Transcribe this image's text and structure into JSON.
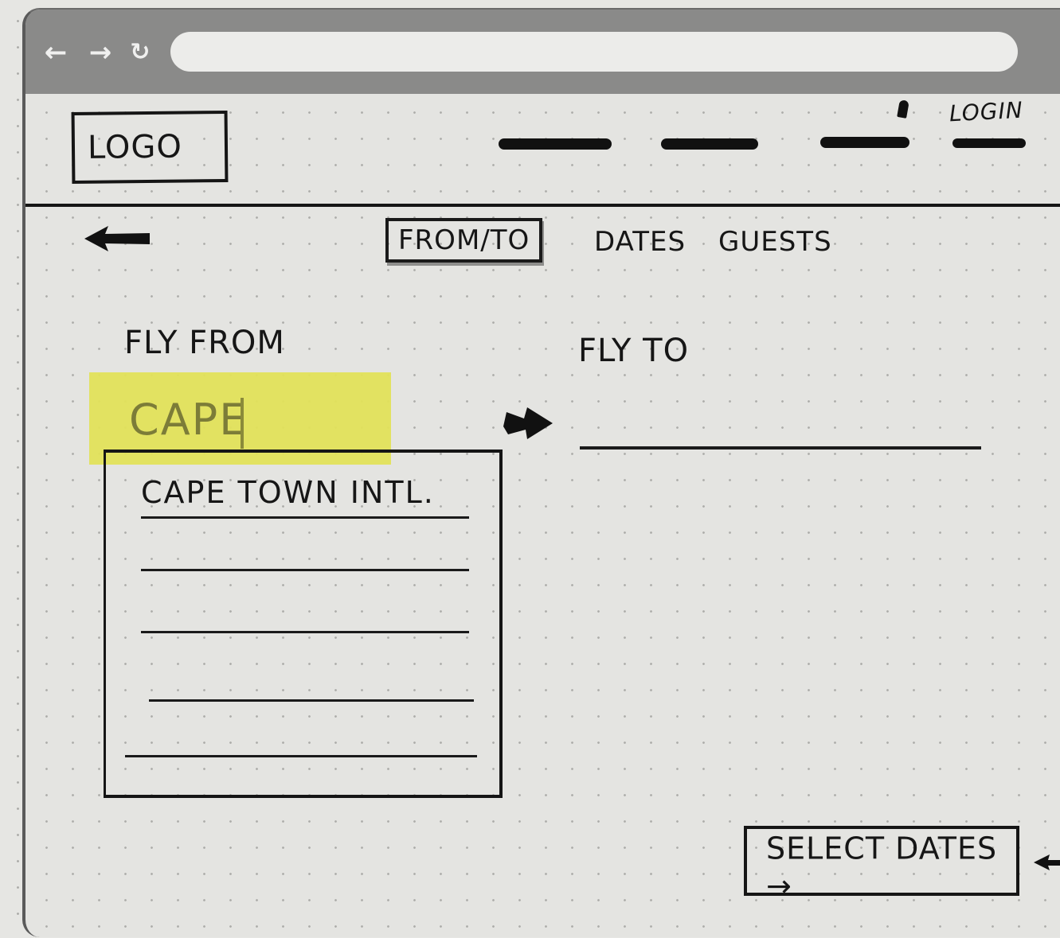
{
  "header": {
    "logo_label": "LOGO",
    "login_label": "LOGIN"
  },
  "steps": {
    "tabs": [
      {
        "label": "FROM/TO",
        "active": true
      },
      {
        "label": "DATES",
        "active": false
      },
      {
        "label": "GUESTS",
        "active": false
      }
    ]
  },
  "form": {
    "from_label": "FLY FROM",
    "from_value": "CAPE",
    "to_label": "FLY TO",
    "to_value": ""
  },
  "dropdown": {
    "items": [
      "CAPE TOWN INTL.",
      "",
      "",
      "",
      ""
    ]
  },
  "actions": {
    "select_dates_label": "SELECT DATES →"
  },
  "colors": {
    "highlight": "#e2e25a",
    "ink": "#161616",
    "browser_chrome": "#8a8a89"
  },
  "icons": {
    "back": "arrow-left-icon",
    "forward": "arrow-right-icon",
    "reload": "reload-icon",
    "menu": "kebab-menu-icon",
    "swap": "arrow-right-icon"
  }
}
